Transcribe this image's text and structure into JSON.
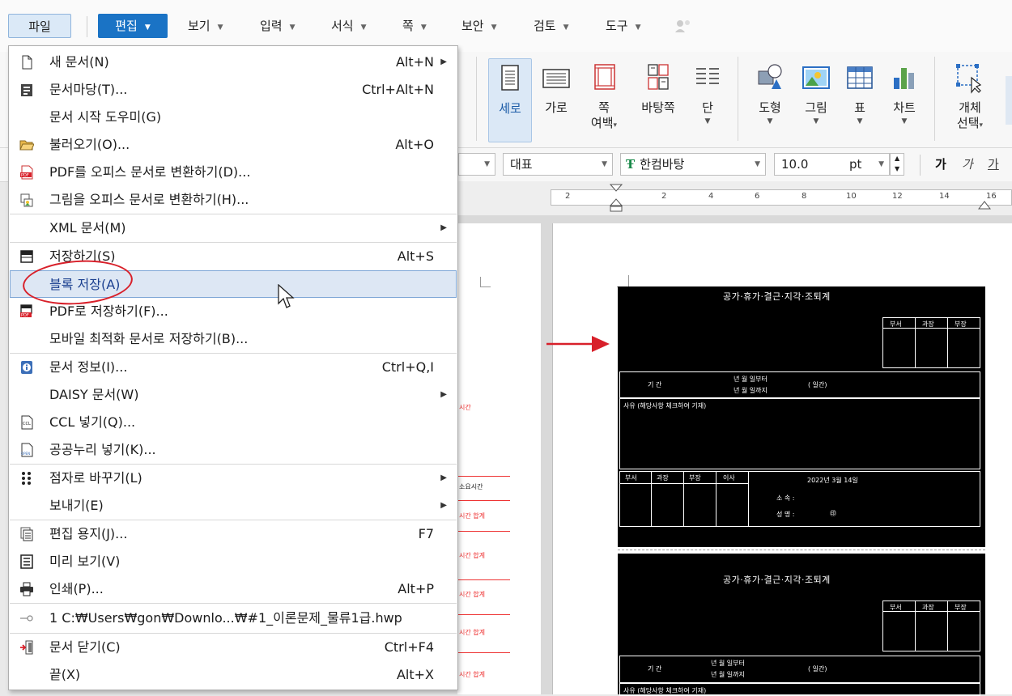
{
  "menubar": {
    "tabs": [
      {
        "name": "file",
        "label": "파일"
      },
      {
        "name": "edit",
        "label": "편집"
      },
      {
        "name": "view",
        "label": "보기"
      },
      {
        "name": "input",
        "label": "입력"
      },
      {
        "name": "format",
        "label": "서식"
      },
      {
        "name": "page",
        "label": "쪽"
      },
      {
        "name": "security",
        "label": "보안"
      },
      {
        "name": "review",
        "label": "검토"
      },
      {
        "name": "tools",
        "label": "도구"
      }
    ]
  },
  "ribbon": {
    "portrait": "세로",
    "landscape": "가로",
    "page_margin_1": "쪽",
    "page_margin_2": "여백",
    "background_page": "바탕쪽",
    "columns": "단",
    "shapes": "도형",
    "picture": "그림",
    "table": "표",
    "chart": "차트",
    "select_object_1": "개체",
    "select_object_2": "선택"
  },
  "formatbar": {
    "style": "대표",
    "font": "한컴바탕",
    "font_size": "10.0",
    "size_unit": "pt",
    "bold": "가",
    "italic": "가",
    "underline": "가"
  },
  "ruler": {
    "ticks": [
      "2",
      "2",
      "4",
      "6",
      "8",
      "10",
      "12",
      "14",
      "16"
    ]
  },
  "file_menu": {
    "items": [
      {
        "label": "새 문서(N)",
        "shortcut": "Alt+N",
        "submenu": true,
        "icon": "new-document-icon"
      },
      {
        "label": "문서마당(T)...",
        "shortcut": "Ctrl+Alt+N",
        "submenu": false,
        "icon": "template-icon"
      },
      {
        "label": "문서 시작 도우미(G)",
        "shortcut": "",
        "submenu": false,
        "icon": ""
      },
      {
        "label": "불러오기(O)...",
        "shortcut": "Alt+O",
        "submenu": false,
        "icon": "open-folder-icon"
      },
      {
        "label": "PDF를 오피스 문서로 변환하기(D)...",
        "shortcut": "",
        "submenu": false,
        "icon": "pdf-icon"
      },
      {
        "label": "그림을 오피스 문서로 변환하기(H)...",
        "shortcut": "",
        "submenu": false,
        "icon": "image-convert-icon"
      },
      {
        "label": "XML 문서(M)",
        "shortcut": "",
        "submenu": true,
        "icon": ""
      },
      {
        "label": "저장하기(S)",
        "shortcut": "Alt+S",
        "submenu": false,
        "icon": "save-icon"
      },
      {
        "label": "블록 저장(A)",
        "shortcut": "",
        "submenu": false,
        "icon": "",
        "highlighted": true
      },
      {
        "label": "PDF로 저장하기(F)...",
        "shortcut": "",
        "submenu": false,
        "icon": "pdf-save-icon"
      },
      {
        "label": "모바일 최적화 문서로 저장하기(B)...",
        "shortcut": "",
        "submenu": false,
        "icon": ""
      },
      {
        "label": "문서 정보(I)...",
        "shortcut": "Ctrl+Q,I",
        "submenu": false,
        "icon": "info-icon"
      },
      {
        "label": "DAISY 문서(W)",
        "shortcut": "",
        "submenu": true,
        "icon": ""
      },
      {
        "label": "CCL 넣기(Q)...",
        "shortcut": "",
        "submenu": false,
        "icon": "ccl-icon"
      },
      {
        "label": "공공누리 넣기(K)...",
        "shortcut": "",
        "submenu": false,
        "icon": "kogl-icon"
      },
      {
        "label": "점자로 바꾸기(L)",
        "shortcut": "",
        "submenu": true,
        "icon": "braille-icon"
      },
      {
        "label": "보내기(E)",
        "shortcut": "",
        "submenu": true,
        "icon": ""
      },
      {
        "label": "편집 용지(J)...",
        "shortcut": "F7",
        "submenu": false,
        "icon": "page-setup-icon"
      },
      {
        "label": "미리 보기(V)",
        "shortcut": "",
        "submenu": false,
        "icon": "preview-icon"
      },
      {
        "label": "인쇄(P)...",
        "shortcut": "Alt+P",
        "submenu": false,
        "icon": "printer-icon"
      },
      {
        "label": "1 C:₩Users₩gon₩Downlo...₩#1_이론문제_물류1급.hwp",
        "shortcut": "",
        "submenu": false,
        "icon": "recent-file-icon"
      },
      {
        "label": "문서 닫기(C)",
        "shortcut": "Ctrl+F4",
        "submenu": false,
        "icon": "close-document-icon"
      },
      {
        "label": "끝(X)",
        "shortcut": "Alt+X",
        "submenu": false,
        "icon": ""
      }
    ]
  },
  "left_page": {
    "lines": [
      "시간",
      "소요시간",
      "시간 합계",
      "시간 합계",
      "시간 합계",
      "시간 합계",
      "시간 합계"
    ]
  },
  "right_page": {
    "form_title": "공가·휴가·결근·지각·조퇴계",
    "approval_headers": [
      "부서",
      "과장",
      "부장"
    ],
    "period_label": "기 간",
    "period_rows": [
      "년 월 일부터",
      "년 월 일까지"
    ],
    "period_note": "( 일간)",
    "reason_label": "사유 (해당사항 체크하여 기재)",
    "lower_headers": [
      "부서",
      "과장",
      "부장",
      "이사"
    ],
    "date_text": "2022년 3월 14일",
    "dept_label": "소 속 :",
    "name_label": "성 명 :",
    "seal": "㊞"
  },
  "colors": {
    "accent": "#1a73c5",
    "highlight": "#dde7f4",
    "annotation_red": "#d8202a"
  }
}
